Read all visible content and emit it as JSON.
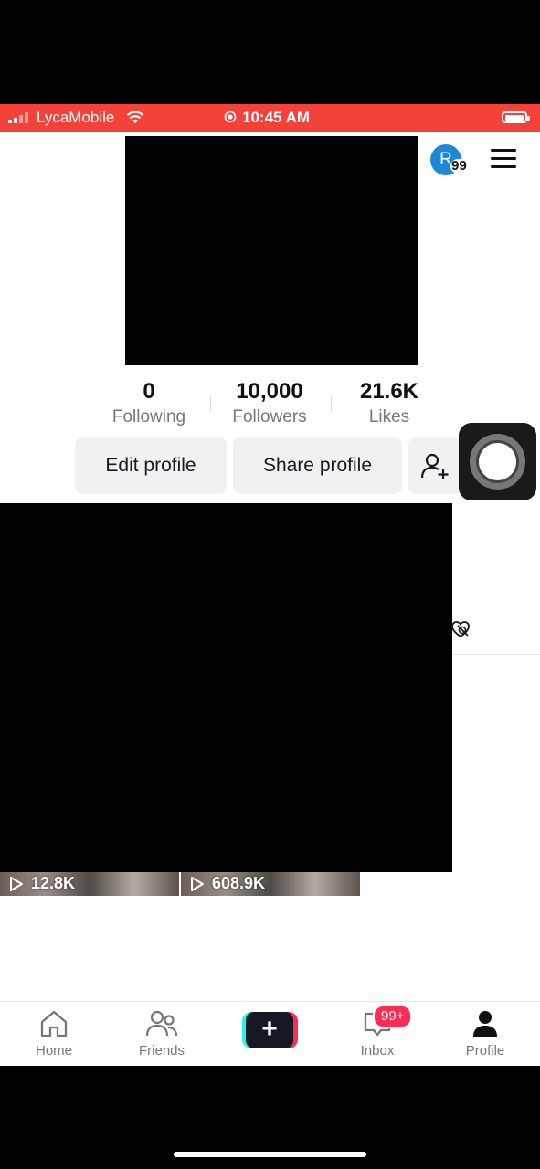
{
  "status_bar": {
    "carrier": "LycaMobile",
    "time": "10:45 AM",
    "background_color": "#f2423a"
  },
  "header": {
    "avatar_letter": "R",
    "avatar_badge": "99",
    "menu_icon": "hamburger-menu-icon"
  },
  "stats": [
    {
      "value": "0",
      "label": "Following"
    },
    {
      "value": "10,000",
      "label": "Followers"
    },
    {
      "value": "21.6K",
      "label": "Likes"
    }
  ],
  "actions": {
    "edit_profile": "Edit profile",
    "share_profile": "Share profile",
    "add_friend_icon": "add-friend-icon"
  },
  "videos": [
    {
      "views": "12.8K"
    },
    {
      "views": "608.9K"
    }
  ],
  "bottom_nav": {
    "home": "Home",
    "friends": "Friends",
    "create_icon": "plus-icon",
    "inbox": "Inbox",
    "inbox_badge": "99+",
    "profile": "Profile"
  },
  "colors": {
    "accent_red": "#fe2c55",
    "accent_cyan": "#25f4ee"
  }
}
